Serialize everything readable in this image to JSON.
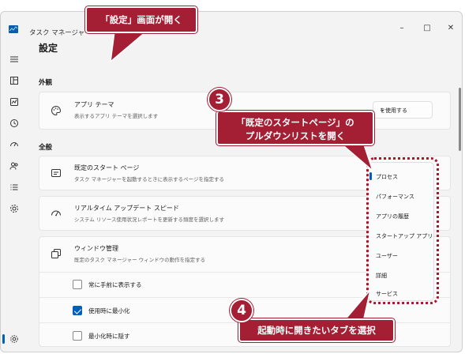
{
  "window": {
    "title": "タスク マネージャー",
    "controls": {
      "minimize": "–",
      "maximize": "□",
      "close": "✕"
    }
  },
  "sidebar": {
    "items": [
      {
        "icon": "hamburger-icon"
      },
      {
        "icon": "processes-icon"
      },
      {
        "icon": "performance-icon"
      },
      {
        "icon": "app-history-icon"
      },
      {
        "icon": "startup-apps-icon"
      },
      {
        "icon": "users-icon"
      },
      {
        "icon": "details-icon"
      },
      {
        "icon": "services-icon"
      },
      {
        "icon": "settings-icon",
        "selected": true
      }
    ]
  },
  "page": {
    "title": "設定",
    "sections": {
      "appearance": "外観",
      "general": "全般"
    },
    "app_theme": {
      "title": "アプリ テーマ",
      "desc": "表示するアプリ テーマを選択します",
      "value": "を使用する"
    },
    "default_start": {
      "title": "既定のスタート ページ",
      "desc": "タスク マネージャーを起動するときに表示するページを指定する"
    },
    "realtime": {
      "title": "リアルタイム アップデート スピード",
      "desc": "システム リソース使用状況レポートを更新する頻度を選択します"
    },
    "window_mgmt": {
      "title": "ウィンドウ管理",
      "desc": "既定のタスク マネージャー ウィンドウの動作を指定する"
    },
    "checkboxes": [
      {
        "label": "常に手前に表示する",
        "checked": false
      },
      {
        "label": "使用時に最小化",
        "checked": true
      },
      {
        "label": "最小化時に隠す",
        "checked": false
      }
    ]
  },
  "start_page_menu": {
    "options": [
      "プロセス",
      "パフォーマンス",
      "アプリの履歴",
      "スタートアップ アプリ",
      "ユーザー",
      "詳細",
      "サービス"
    ],
    "selected": "プロセス"
  },
  "annotations": {
    "callout_top": "「設定」画面が開く",
    "step3_number": "3",
    "step3_text_line1": "「既定のスタートページ」の",
    "step3_text_line2": "プルダウンリストを開く",
    "step4_number": "4",
    "step4_text": "起動時に開きたいタブを選択",
    "callout_color": "#a41e34"
  },
  "colors": {
    "accent": "#005fb8",
    "window_bg": "#f3f3f3",
    "card_bg": "#fbfbfb"
  }
}
